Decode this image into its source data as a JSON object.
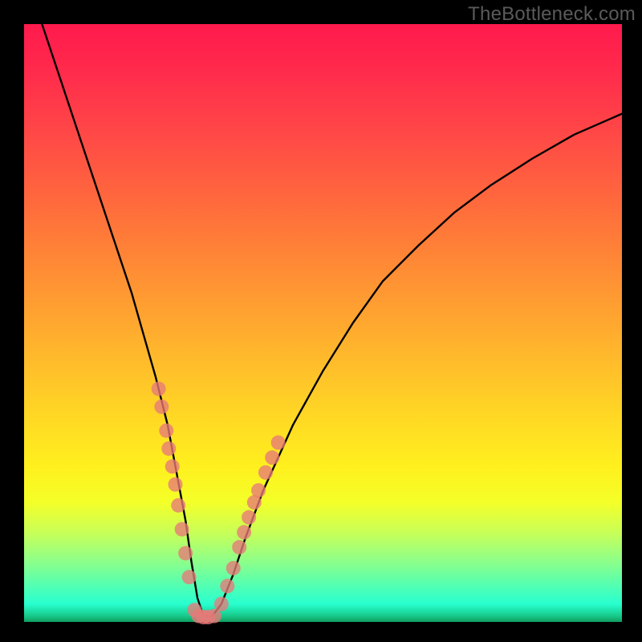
{
  "watermark": "TheBottleneck.com",
  "chart_data": {
    "type": "line",
    "title": "",
    "xlabel": "",
    "ylabel": "",
    "xlim": [
      0,
      100
    ],
    "ylim": [
      0,
      100
    ],
    "series": [
      {
        "name": "bottleneck-curve",
        "x": [
          3,
          6,
          9,
          12,
          15,
          18,
          20,
          22,
          24,
          25.5,
          27,
          28,
          29,
          30,
          31.5,
          33,
          35,
          37,
          40,
          45,
          50,
          55,
          60,
          66,
          72,
          78,
          85,
          92,
          100
        ],
        "values": [
          100,
          91,
          82,
          73,
          64,
          55,
          48,
          41,
          33,
          25,
          17,
          10,
          4,
          1,
          1,
          3,
          8,
          14,
          22,
          33,
          42,
          50,
          57,
          63,
          68.5,
          73,
          77.5,
          81.5,
          85
        ]
      }
    ],
    "markers": {
      "name": "highlight-dots",
      "color": "#e77a78",
      "points": [
        {
          "x": 22.5,
          "y": 39
        },
        {
          "x": 23.0,
          "y": 36
        },
        {
          "x": 23.8,
          "y": 32
        },
        {
          "x": 24.2,
          "y": 29
        },
        {
          "x": 24.8,
          "y": 26
        },
        {
          "x": 25.3,
          "y": 23
        },
        {
          "x": 25.8,
          "y": 19.5
        },
        {
          "x": 26.4,
          "y": 15.5
        },
        {
          "x": 27.0,
          "y": 11.5
        },
        {
          "x": 27.6,
          "y": 7.5
        },
        {
          "x": 28.5,
          "y": 2.0
        },
        {
          "x": 29.2,
          "y": 1.0
        },
        {
          "x": 30.0,
          "y": 0.8
        },
        {
          "x": 30.8,
          "y": 0.8
        },
        {
          "x": 31.8,
          "y": 1.0
        },
        {
          "x": 33.0,
          "y": 3.0
        },
        {
          "x": 34.0,
          "y": 6.0
        },
        {
          "x": 35.0,
          "y": 9.0
        },
        {
          "x": 36.0,
          "y": 12.5
        },
        {
          "x": 36.8,
          "y": 15.0
        },
        {
          "x": 37.6,
          "y": 17.5
        },
        {
          "x": 38.5,
          "y": 20.0
        },
        {
          "x": 39.2,
          "y": 22.0
        },
        {
          "x": 40.4,
          "y": 25.0
        },
        {
          "x": 41.5,
          "y": 27.5
        },
        {
          "x": 42.5,
          "y": 30.0
        }
      ]
    }
  }
}
